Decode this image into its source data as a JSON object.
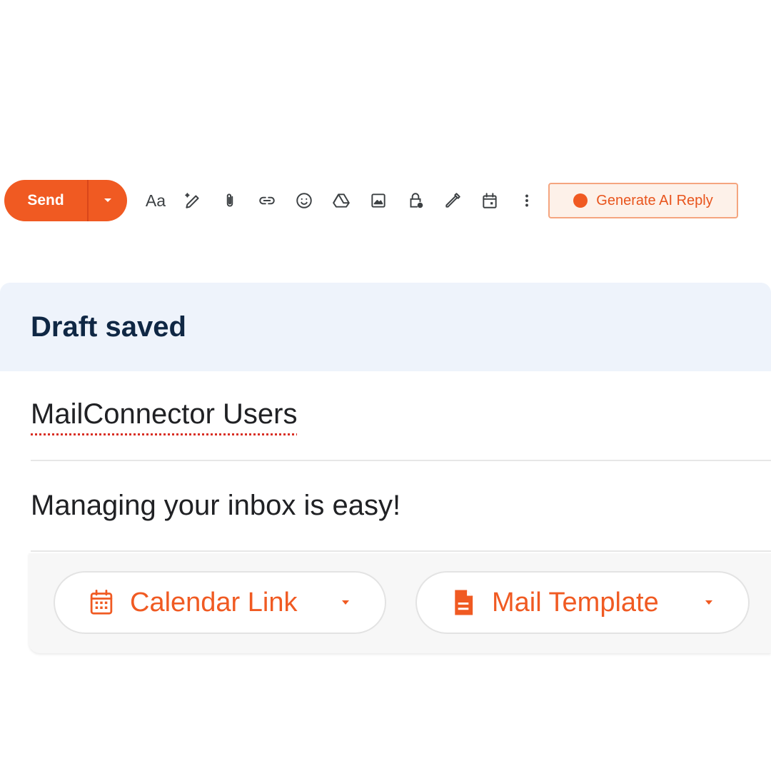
{
  "toolbar": {
    "send_label": "Send",
    "send_dropdown_icon": "caret-down-icon",
    "format_label": "Aa",
    "icons": [
      "format-text-icon",
      "magic-pen-icon",
      "attachment-icon",
      "link-icon",
      "emoji-icon",
      "drive-icon",
      "image-icon",
      "confidential-lock-icon",
      "signature-pen-icon",
      "calendar-event-icon",
      "more-vertical-icon"
    ],
    "ai_button_label": "Generate AI Reply"
  },
  "compose": {
    "status": "Draft saved",
    "to": "MailConnector Users",
    "subject": "Managing your inbox is easy!"
  },
  "chips": {
    "calendar_label": "Calendar Link",
    "template_label": "Mail Template"
  },
  "colors": {
    "accent": "#f05a22",
    "banner_bg": "#eef3fb",
    "ai_button_bg": "#fdf1e9"
  }
}
